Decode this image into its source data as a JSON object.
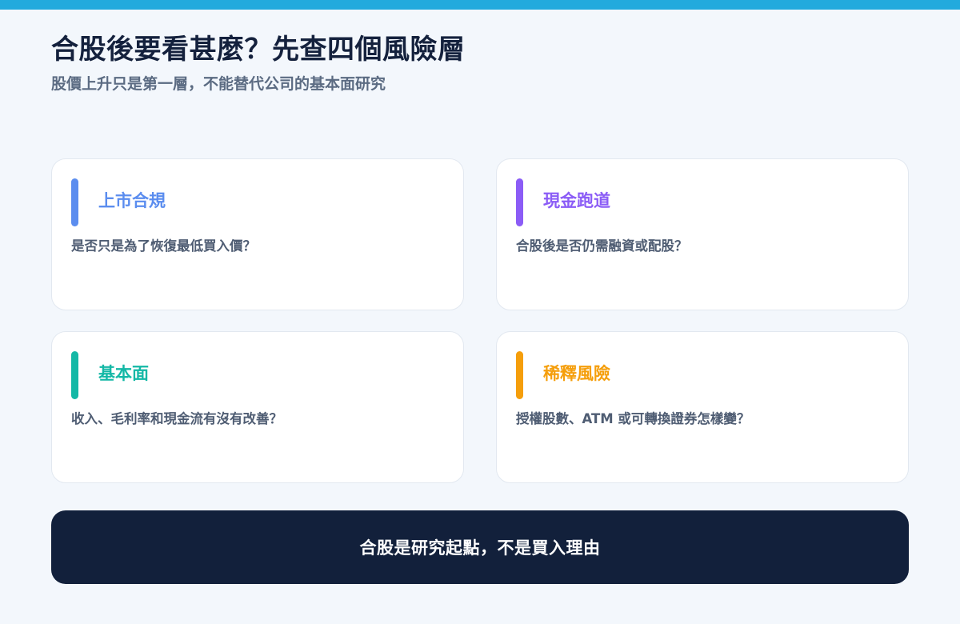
{
  "colors": {
    "top_bar": "#22aadd",
    "banner_bg": "#12203b"
  },
  "header": {
    "title": "合股後要看甚麼？先查四個風險層",
    "subtitle": "股價上升只是第一層，不能替代公司的基本面研究"
  },
  "cards": [
    {
      "title": "上市合規",
      "desc": "是否只是為了恢復最低買入價？",
      "color": "#5b8def"
    },
    {
      "title": "現金跑道",
      "desc": "合股後是否仍需融資或配股？",
      "color": "#8b5cf6"
    },
    {
      "title": "基本面",
      "desc": "收入、毛利率和現金流有沒有改善？",
      "color": "#14b8a6"
    },
    {
      "title": "稀釋風險",
      "desc": "授權股數、ATM 或可轉換證券怎樣變？",
      "color": "#f59e0b"
    }
  ],
  "banner": {
    "text": "合股是研究起點，不是買入理由"
  }
}
